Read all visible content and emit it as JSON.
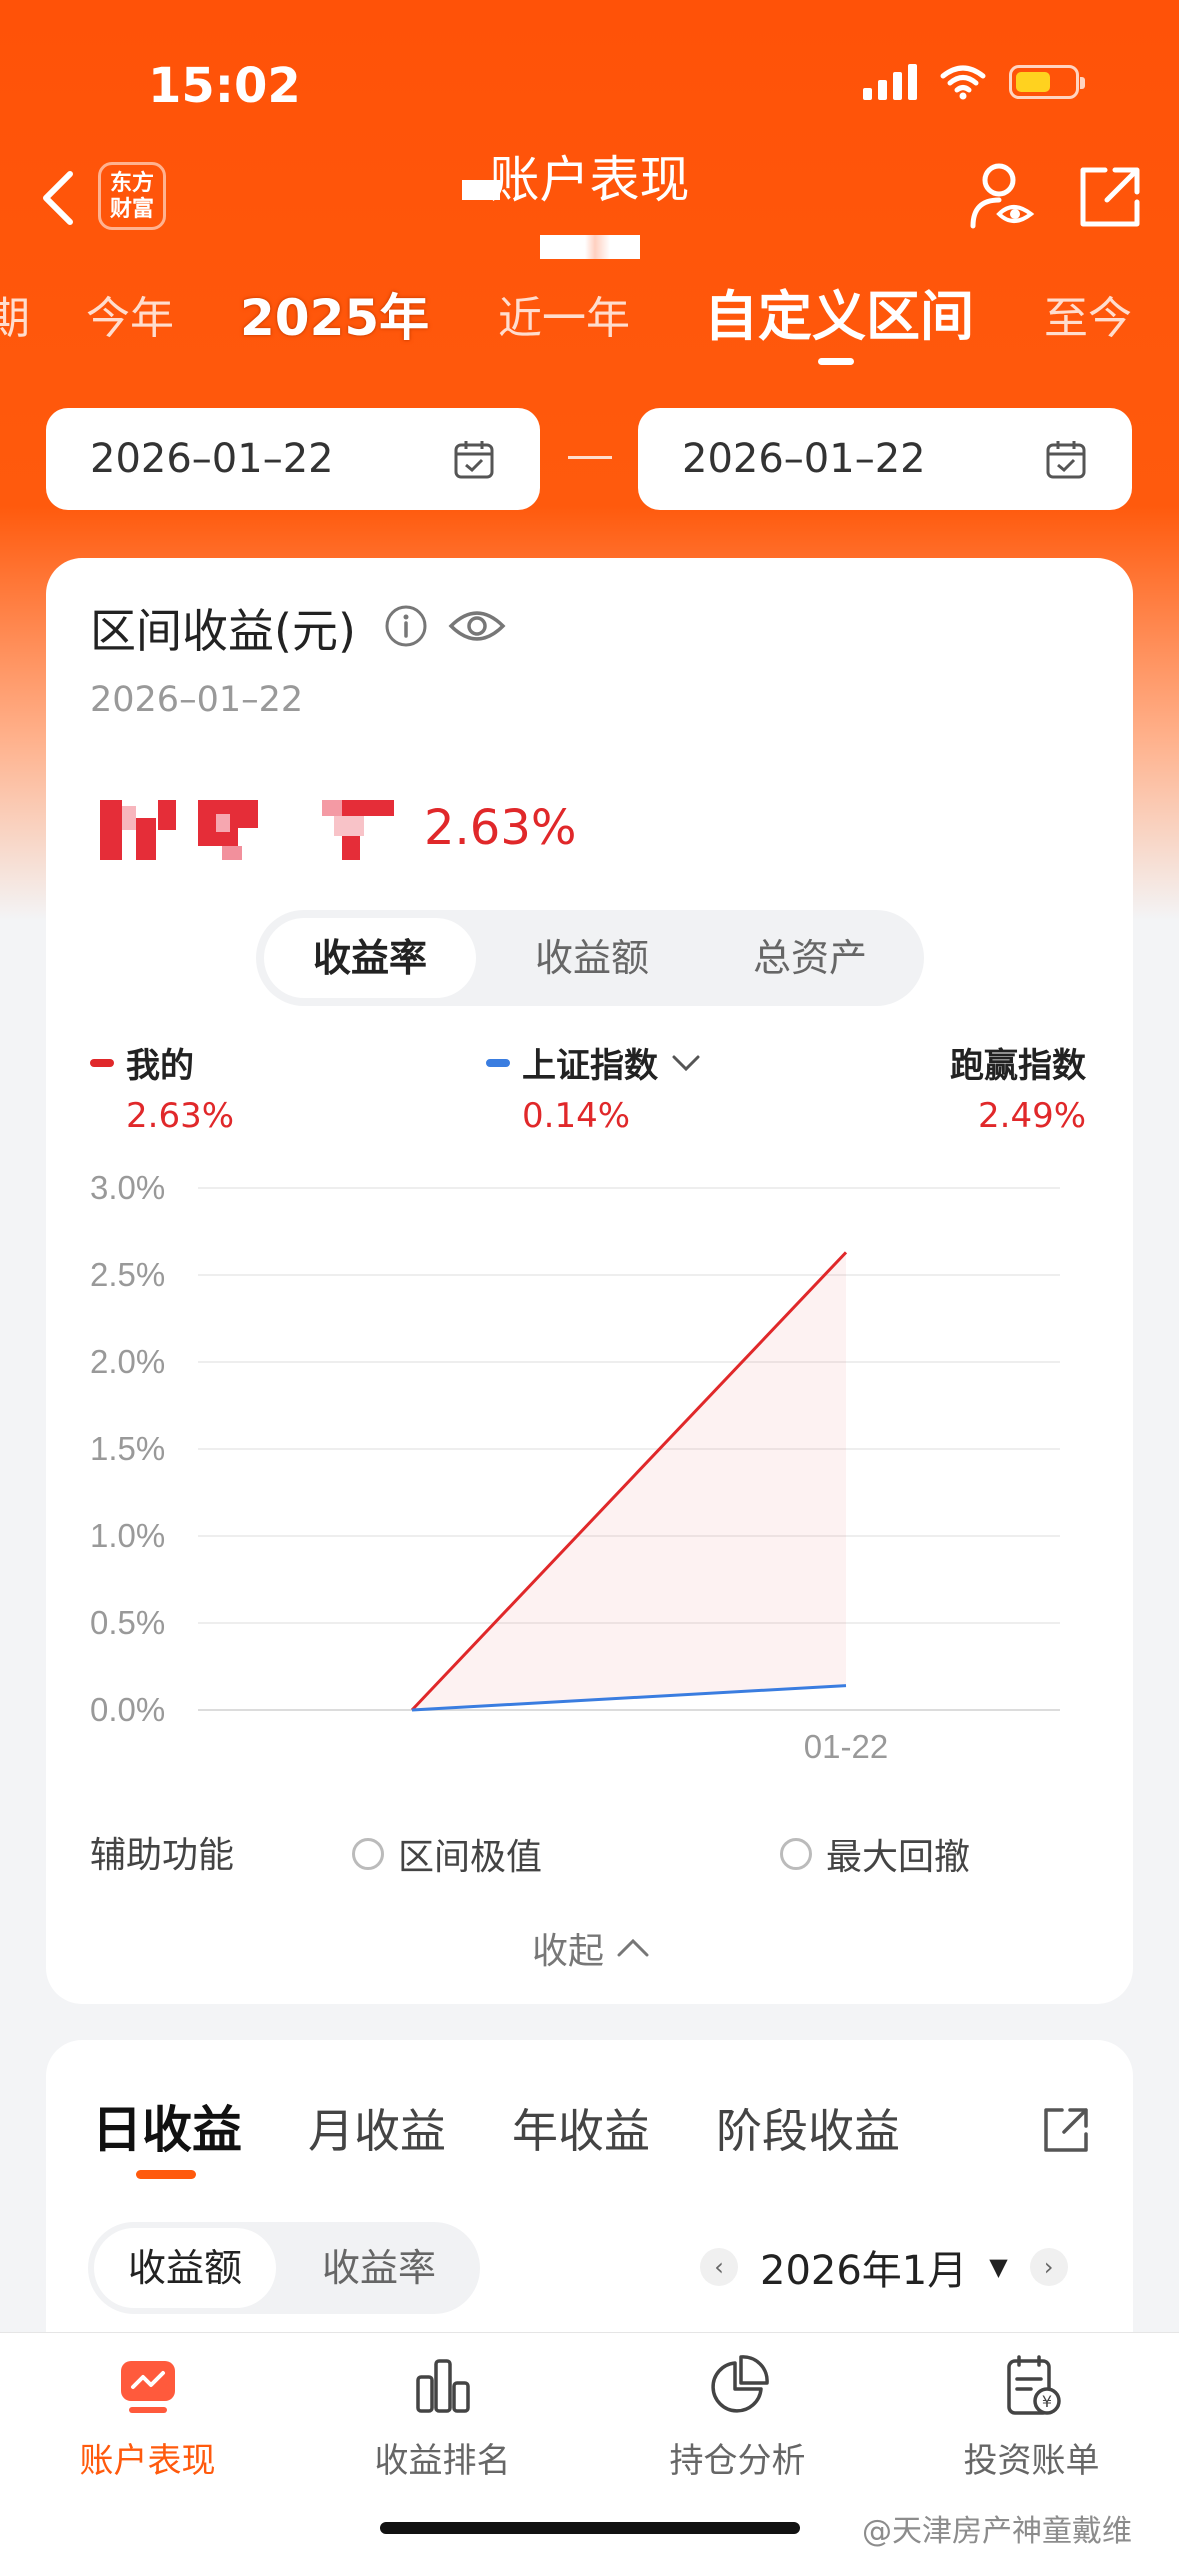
{
  "status_bar": {
    "time": "15:02"
  },
  "nav": {
    "logo_text": "东方财富",
    "title": "账户表现"
  },
  "period_tabs": [
    "今年",
    "2025年",
    "近一年",
    "自定义区间",
    "至今"
  ],
  "date_range": {
    "start": "2026–01–22",
    "end": "2026–01–22"
  },
  "summary": {
    "title": "区间收益(元)",
    "date": "2026–01–22",
    "profit_rate": "2.63%"
  },
  "chart_tabs": [
    "收益率",
    "收益额",
    "总资产"
  ],
  "legend": {
    "mine": {
      "label": "我的",
      "value": "2.63%",
      "color": "#e0282a"
    },
    "index": {
      "label": "上证指数",
      "value": "0.14%",
      "color": "#3a7de0"
    },
    "excess": {
      "label": "跑赢指数",
      "value": "2.49%"
    }
  },
  "chart_data": {
    "type": "line",
    "x": [
      "start",
      "01-22"
    ],
    "x_tick_labels": [
      "01-22"
    ],
    "series": [
      {
        "name": "我的",
        "values": [
          0.0,
          2.63
        ],
        "color": "#e0282a"
      },
      {
        "name": "上证指数",
        "values": [
          0.0,
          0.14
        ],
        "color": "#3a7de0"
      }
    ],
    "y_ticks": [
      "0.0%",
      "0.5%",
      "1.0%",
      "1.5%",
      "2.0%",
      "2.5%",
      "3.0%"
    ],
    "ylim": [
      0,
      3.0
    ],
    "grid": true
  },
  "aux": {
    "label": "辅助功能",
    "option1": "区间极值",
    "option2": "最大回撤",
    "collapse": "收起"
  },
  "daily_tabs": [
    "日收益",
    "月收益",
    "年收益",
    "阶段收益"
  ],
  "daily_segment": [
    "收益额",
    "收益率"
  ],
  "month_selector": "2026年1月",
  "bottom_nav": [
    "账户表现",
    "收益排名",
    "持仓分析",
    "投资账单"
  ],
  "watermark": "@天津房产神童戴维"
}
